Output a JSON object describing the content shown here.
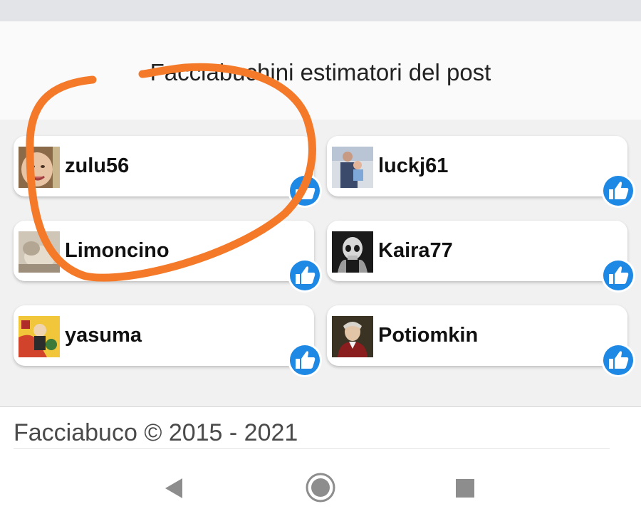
{
  "header": {
    "title": "Facciabuchini estimatori del post"
  },
  "users": [
    {
      "name": "zulu56",
      "avatar": "baby-photo"
    },
    {
      "name": "luckj61",
      "avatar": "person-photo"
    },
    {
      "name": "Limoncino",
      "avatar": "blurred-photo"
    },
    {
      "name": "Kaira77",
      "avatar": "skull-photo"
    },
    {
      "name": "yasuma",
      "avatar": "cartoon-photo"
    },
    {
      "name": "Potiomkin",
      "avatar": "portrait-painting"
    }
  ],
  "footer": {
    "copyright": "Facciabuco © 2015 - 2021"
  },
  "nav": {
    "back": "back-triangle-icon",
    "home": "home-circle-icon",
    "recents": "recents-square-icon"
  },
  "colors": {
    "like_blue": "#1e88e5",
    "annotation_orange": "#f47a2a"
  }
}
